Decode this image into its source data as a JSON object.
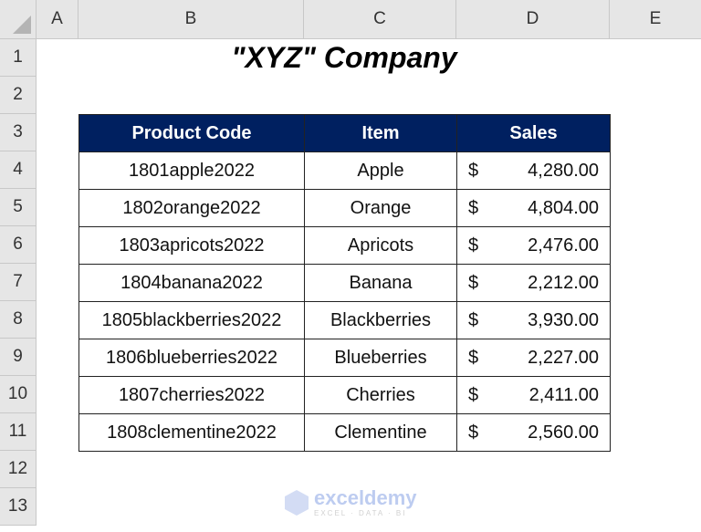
{
  "columns": [
    "A",
    "B",
    "C",
    "D",
    "E"
  ],
  "rows": [
    "1",
    "2",
    "3",
    "4",
    "5",
    "6",
    "7",
    "8",
    "9",
    "10",
    "11",
    "12",
    "13"
  ],
  "title": "\"XYZ\" Company",
  "table": {
    "headers": [
      "Product Code",
      "Item",
      "Sales"
    ],
    "currency_symbol": "$",
    "rows": [
      {
        "code": "1801apple2022",
        "item": "Apple",
        "sales": "4,280.00"
      },
      {
        "code": "1802orange2022",
        "item": "Orange",
        "sales": "4,804.00"
      },
      {
        "code": "1803apricots2022",
        "item": "Apricots",
        "sales": "2,476.00"
      },
      {
        "code": "1804banana2022",
        "item": "Banana",
        "sales": "2,212.00"
      },
      {
        "code": "1805blackberries2022",
        "item": "Blackberries",
        "sales": "3,930.00"
      },
      {
        "code": "1806blueberries2022",
        "item": "Blueberries",
        "sales": "2,227.00"
      },
      {
        "code": "1807cherries2022",
        "item": "Cherries",
        "sales": "2,411.00"
      },
      {
        "code": "1808clementine2022",
        "item": "Clementine",
        "sales": "2,560.00"
      }
    ]
  },
  "colors": {
    "header_fill": "#002060",
    "header_text": "#ffffff"
  },
  "watermark": {
    "name": "exceldemy",
    "tagline": "EXCEL · DATA · BI"
  }
}
